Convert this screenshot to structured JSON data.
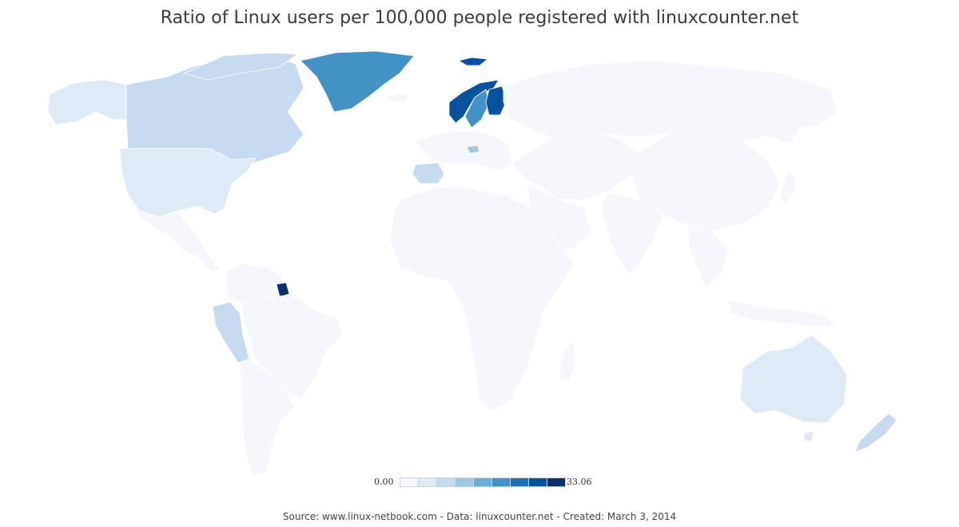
{
  "map": {
    "title": "Ratio of Linux users per 100,000 people registered with linuxcounter.net",
    "legend": {
      "min_label": "0.00",
      "max_label": "33.06",
      "colors": [
        "#f4f8fc",
        "#deebf7",
        "#c6dbef",
        "#9ecae1",
        "#6baed6",
        "#4292c6",
        "#2171b5",
        "#08519c",
        "#08306b"
      ]
    },
    "no_data_color": "#eeeeee",
    "base_color": "#f4f8fc",
    "regions": [
      {
        "region": "Greenland",
        "color": "#4292c6"
      },
      {
        "region": "Finland",
        "color": "#08519c"
      },
      {
        "region": "Norway",
        "color": "#08519c"
      },
      {
        "region": "Sweden",
        "color": "#4292c6"
      },
      {
        "region": "Suriname",
        "color": "#08306b"
      },
      {
        "region": "Canada",
        "color": "#c6dbef"
      },
      {
        "region": "United States",
        "color": "#deebf7"
      },
      {
        "region": "Australia",
        "color": "#deebf7"
      },
      {
        "region": "New Zealand",
        "color": "#c6dbef"
      },
      {
        "region": "Peru",
        "color": "#c6dbef"
      },
      {
        "region": "Spain",
        "color": "#c6dbef"
      },
      {
        "region": "Switzerland",
        "color": "#9ecae1"
      },
      {
        "region": "Russia",
        "color": "#f4f8fc"
      },
      {
        "region": "China",
        "color": "#f4f8fc"
      },
      {
        "region": "Brazil",
        "color": "#f4f8fc"
      },
      {
        "region": "Africa",
        "color": "#f4f8fc"
      }
    ]
  },
  "footer": {
    "credit": "Source: www.linux-netbook.com - Data: linuxcounter.net - Created: March 3, 2014"
  }
}
